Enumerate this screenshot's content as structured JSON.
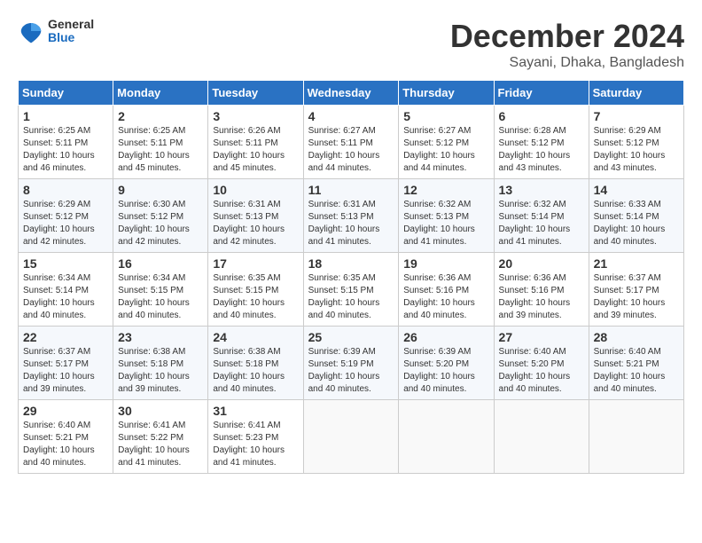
{
  "header": {
    "logo": {
      "general": "General",
      "blue": "Blue"
    },
    "title": "December 2024",
    "location": "Sayani, Dhaka, Bangladesh"
  },
  "weekdays": [
    "Sunday",
    "Monday",
    "Tuesday",
    "Wednesday",
    "Thursday",
    "Friday",
    "Saturday"
  ],
  "weeks": [
    [
      {
        "day": "1",
        "sunrise": "6:25 AM",
        "sunset": "5:11 PM",
        "daylight": "10 hours and 46 minutes."
      },
      {
        "day": "2",
        "sunrise": "6:25 AM",
        "sunset": "5:11 PM",
        "daylight": "10 hours and 45 minutes."
      },
      {
        "day": "3",
        "sunrise": "6:26 AM",
        "sunset": "5:11 PM",
        "daylight": "10 hours and 45 minutes."
      },
      {
        "day": "4",
        "sunrise": "6:27 AM",
        "sunset": "5:11 PM",
        "daylight": "10 hours and 44 minutes."
      },
      {
        "day": "5",
        "sunrise": "6:27 AM",
        "sunset": "5:12 PM",
        "daylight": "10 hours and 44 minutes."
      },
      {
        "day": "6",
        "sunrise": "6:28 AM",
        "sunset": "5:12 PM",
        "daylight": "10 hours and 43 minutes."
      },
      {
        "day": "7",
        "sunrise": "6:29 AM",
        "sunset": "5:12 PM",
        "daylight": "10 hours and 43 minutes."
      }
    ],
    [
      {
        "day": "8",
        "sunrise": "6:29 AM",
        "sunset": "5:12 PM",
        "daylight": "10 hours and 42 minutes."
      },
      {
        "day": "9",
        "sunrise": "6:30 AM",
        "sunset": "5:12 PM",
        "daylight": "10 hours and 42 minutes."
      },
      {
        "day": "10",
        "sunrise": "6:31 AM",
        "sunset": "5:13 PM",
        "daylight": "10 hours and 42 minutes."
      },
      {
        "day": "11",
        "sunrise": "6:31 AM",
        "sunset": "5:13 PM",
        "daylight": "10 hours and 41 minutes."
      },
      {
        "day": "12",
        "sunrise": "6:32 AM",
        "sunset": "5:13 PM",
        "daylight": "10 hours and 41 minutes."
      },
      {
        "day": "13",
        "sunrise": "6:32 AM",
        "sunset": "5:14 PM",
        "daylight": "10 hours and 41 minutes."
      },
      {
        "day": "14",
        "sunrise": "6:33 AM",
        "sunset": "5:14 PM",
        "daylight": "10 hours and 40 minutes."
      }
    ],
    [
      {
        "day": "15",
        "sunrise": "6:34 AM",
        "sunset": "5:14 PM",
        "daylight": "10 hours and 40 minutes."
      },
      {
        "day": "16",
        "sunrise": "6:34 AM",
        "sunset": "5:15 PM",
        "daylight": "10 hours and 40 minutes."
      },
      {
        "day": "17",
        "sunrise": "6:35 AM",
        "sunset": "5:15 PM",
        "daylight": "10 hours and 40 minutes."
      },
      {
        "day": "18",
        "sunrise": "6:35 AM",
        "sunset": "5:15 PM",
        "daylight": "10 hours and 40 minutes."
      },
      {
        "day": "19",
        "sunrise": "6:36 AM",
        "sunset": "5:16 PM",
        "daylight": "10 hours and 40 minutes."
      },
      {
        "day": "20",
        "sunrise": "6:36 AM",
        "sunset": "5:16 PM",
        "daylight": "10 hours and 39 minutes."
      },
      {
        "day": "21",
        "sunrise": "6:37 AM",
        "sunset": "5:17 PM",
        "daylight": "10 hours and 39 minutes."
      }
    ],
    [
      {
        "day": "22",
        "sunrise": "6:37 AM",
        "sunset": "5:17 PM",
        "daylight": "10 hours and 39 minutes."
      },
      {
        "day": "23",
        "sunrise": "6:38 AM",
        "sunset": "5:18 PM",
        "daylight": "10 hours and 39 minutes."
      },
      {
        "day": "24",
        "sunrise": "6:38 AM",
        "sunset": "5:18 PM",
        "daylight": "10 hours and 40 minutes."
      },
      {
        "day": "25",
        "sunrise": "6:39 AM",
        "sunset": "5:19 PM",
        "daylight": "10 hours and 40 minutes."
      },
      {
        "day": "26",
        "sunrise": "6:39 AM",
        "sunset": "5:20 PM",
        "daylight": "10 hours and 40 minutes."
      },
      {
        "day": "27",
        "sunrise": "6:40 AM",
        "sunset": "5:20 PM",
        "daylight": "10 hours and 40 minutes."
      },
      {
        "day": "28",
        "sunrise": "6:40 AM",
        "sunset": "5:21 PM",
        "daylight": "10 hours and 40 minutes."
      }
    ],
    [
      {
        "day": "29",
        "sunrise": "6:40 AM",
        "sunset": "5:21 PM",
        "daylight": "10 hours and 40 minutes."
      },
      {
        "day": "30",
        "sunrise": "6:41 AM",
        "sunset": "5:22 PM",
        "daylight": "10 hours and 41 minutes."
      },
      {
        "day": "31",
        "sunrise": "6:41 AM",
        "sunset": "5:23 PM",
        "daylight": "10 hours and 41 minutes."
      },
      null,
      null,
      null,
      null
    ]
  ]
}
